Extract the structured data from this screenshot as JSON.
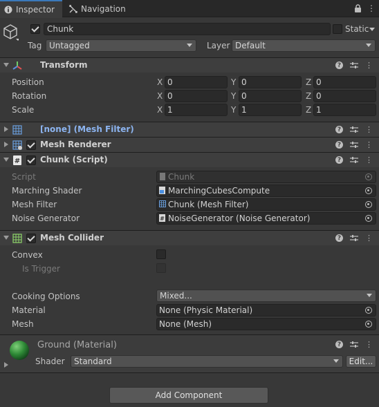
{
  "tabs": [
    {
      "label": "Inspector",
      "icon": "info-icon"
    },
    {
      "label": "Navigation",
      "icon": "navigation-icon"
    }
  ],
  "object": {
    "name": "Chunk",
    "active": true,
    "static_label": "Static",
    "tag_label": "Tag",
    "tag_value": "Untagged",
    "layer_label": "Layer",
    "layer_value": "Default"
  },
  "transform": {
    "title": "Transform",
    "rows": [
      {
        "label": "Position",
        "x": "0",
        "y": "0",
        "z": "0"
      },
      {
        "label": "Rotation",
        "x": "0",
        "y": "0",
        "z": "0"
      },
      {
        "label": "Scale",
        "x": "1",
        "y": "1",
        "z": "1"
      }
    ],
    "axis": {
      "x": "X",
      "y": "Y",
      "z": "Z"
    }
  },
  "mesh_filter": {
    "title": "[none] (Mesh Filter)"
  },
  "mesh_renderer": {
    "title": "Mesh Renderer"
  },
  "chunk_script": {
    "title": "Chunk (Script)",
    "rows": [
      {
        "label": "Script",
        "value": "Chunk"
      },
      {
        "label": "Marching Shader",
        "value": "MarchingCubesCompute"
      },
      {
        "label": "Mesh Filter",
        "value": "Chunk (Mesh Filter)"
      },
      {
        "label": "Noise Generator",
        "value": "NoiseGenerator (Noise Generator)"
      }
    ]
  },
  "mesh_collider": {
    "title": "Mesh Collider",
    "convex_label": "Convex",
    "is_trigger_label": "Is Trigger",
    "cooking_label": "Cooking Options",
    "cooking_value": "Mixed...",
    "material_label": "Material",
    "material_value": "None (Physic Material)",
    "mesh_label": "Mesh",
    "mesh_value": "None (Mesh)"
  },
  "material": {
    "title": "Ground (Material)",
    "shader_label": "Shader",
    "shader_value": "Standard",
    "edit_label": "Edit..."
  },
  "add_component_label": "Add Component",
  "colors": {
    "accent": "#3a79bb",
    "background": "#383838",
    "header": "#3e3e3e"
  }
}
